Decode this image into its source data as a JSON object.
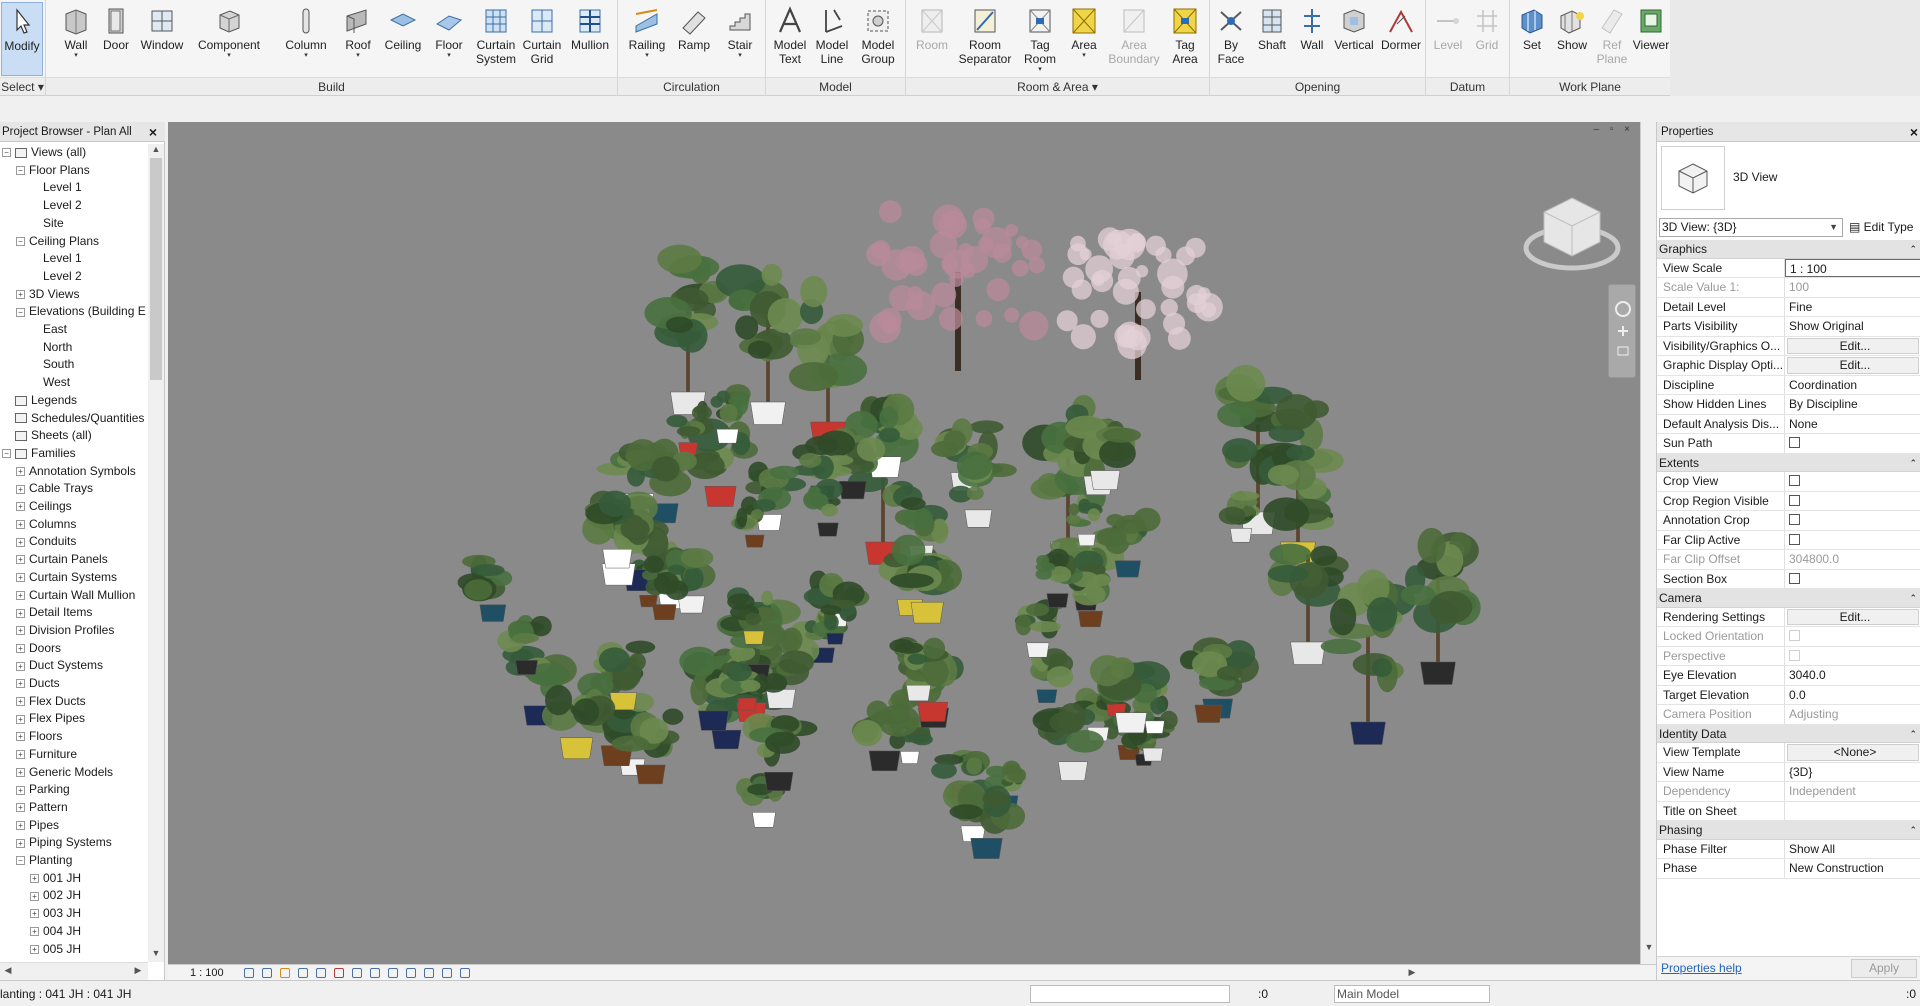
{
  "ribbon": {
    "tools": [
      {
        "label": "Modify",
        "icon": "cursor-icon"
      },
      {
        "label": "Wall",
        "icon": "wall-icon"
      },
      {
        "label": "Door",
        "icon": "door-icon"
      },
      {
        "label": "Window",
        "icon": "window-icon"
      },
      {
        "label": "Component",
        "icon": "component-icon"
      },
      {
        "label": "Column",
        "icon": "column-icon"
      },
      {
        "label": "Roof",
        "icon": "roof-icon"
      },
      {
        "label": "Ceiling",
        "icon": "ceiling-icon"
      },
      {
        "label": "Floor",
        "icon": "floor-icon"
      },
      {
        "label": "Curtain\nSystem",
        "icon": "curtain-system-icon"
      },
      {
        "label": "Curtain\nGrid",
        "icon": "curtain-grid-icon"
      },
      {
        "label": "Mullion",
        "icon": "mullion-icon"
      },
      {
        "label": "Railing",
        "icon": "railing-icon"
      },
      {
        "label": "Ramp",
        "icon": "ramp-icon"
      },
      {
        "label": "Stair",
        "icon": "stair-icon"
      },
      {
        "label": "Model\nText",
        "icon": "model-text-icon"
      },
      {
        "label": "Model\nLine",
        "icon": "model-line-icon"
      },
      {
        "label": "Model\nGroup",
        "icon": "model-group-icon"
      },
      {
        "label": "Room",
        "icon": "room-icon"
      },
      {
        "label": "Room\nSeparator",
        "icon": "room-separator-icon"
      },
      {
        "label": "Tag\nRoom",
        "icon": "tag-room-icon"
      },
      {
        "label": "Area",
        "icon": "area-icon"
      },
      {
        "label": "Area\nBoundary",
        "icon": "area-boundary-icon"
      },
      {
        "label": "Tag\nArea",
        "icon": "tag-area-icon"
      },
      {
        "label": "By\nFace",
        "icon": "by-face-icon"
      },
      {
        "label": "Shaft",
        "icon": "shaft-icon"
      },
      {
        "label": "Wall",
        "icon": "wall-opening-icon"
      },
      {
        "label": "Vertical",
        "icon": "vertical-opening-icon"
      },
      {
        "label": "Dormer",
        "icon": "dormer-icon"
      },
      {
        "label": "Level",
        "icon": "level-icon"
      },
      {
        "label": "Grid",
        "icon": "grid-icon"
      },
      {
        "label": "Set",
        "icon": "set-workplane-icon"
      },
      {
        "label": "Show",
        "icon": "show-workplane-icon"
      },
      {
        "label": "Ref\nPlane",
        "icon": "ref-plane-icon"
      },
      {
        "label": "Viewer",
        "icon": "viewer-icon"
      }
    ],
    "panels": [
      "Select",
      "Build",
      "Circulation",
      "Model",
      "Room & Area",
      "Opening",
      "Datum",
      "Work Plane"
    ]
  },
  "browser": {
    "title": "Project Browser - Plan All",
    "items": [
      "Views (all)",
      "Floor Plans",
      "Level 1",
      "Level 2",
      "Site",
      "Ceiling Plans",
      "Level 1",
      "Level 2",
      "3D Views",
      "Elevations (Building E",
      "East",
      "North",
      "South",
      "West",
      "Legends",
      "Schedules/Quantities",
      "Sheets (all)",
      "Families",
      "Annotation Symbols",
      "Cable Trays",
      "Ceilings",
      "Columns",
      "Conduits",
      "Curtain Panels",
      "Curtain Systems",
      "Curtain Wall Mullion",
      "Detail Items",
      "Division Profiles",
      "Doors",
      "Duct Systems",
      "Ducts",
      "Flex Ducts",
      "Flex Pipes",
      "Floors",
      "Furniture",
      "Generic Models",
      "Parking",
      "Pattern",
      "Pipes",
      "Piping Systems",
      "Planting",
      "001 JH",
      "002 JH",
      "003 JH",
      "004 JH",
      "005 JH"
    ]
  },
  "view": {
    "scale": "1 : 100",
    "window_controls": "– ▫ ×"
  },
  "properties": {
    "title": "Properties",
    "type_name": "3D View",
    "instance_selector": "3D View: {3D}",
    "edit_type": "Edit Type",
    "groups": [
      {
        "name": "Graphics",
        "rows": [
          {
            "name": "View Scale",
            "value": "1 : 100"
          },
          {
            "name": "Scale Value    1:",
            "value": "100"
          },
          {
            "name": "Detail Level",
            "value": "Fine"
          },
          {
            "name": "Parts Visibility",
            "value": "Show Original"
          },
          {
            "name": "Visibility/Graphics O...",
            "value": "Edit..."
          },
          {
            "name": "Graphic Display Opti...",
            "value": "Edit..."
          },
          {
            "name": "Discipline",
            "value": "Coordination"
          },
          {
            "name": "Show Hidden Lines",
            "value": "By Discipline"
          },
          {
            "name": "Default Analysis Dis...",
            "value": "None"
          },
          {
            "name": "Sun Path",
            "value": "unchecked"
          }
        ]
      },
      {
        "name": "Extents",
        "rows": [
          {
            "name": "Crop View",
            "value": "unchecked"
          },
          {
            "name": "Crop Region Visible",
            "value": "unchecked"
          },
          {
            "name": "Annotation Crop",
            "value": "unchecked"
          },
          {
            "name": "Far Clip Active",
            "value": "unchecked"
          },
          {
            "name": "Far Clip Offset",
            "value": "304800.0"
          },
          {
            "name": "Section Box",
            "value": "unchecked"
          }
        ]
      },
      {
        "name": "Camera",
        "rows": [
          {
            "name": "Rendering Settings",
            "value": "Edit..."
          },
          {
            "name": "Locked Orientation",
            "value": "unchecked"
          },
          {
            "name": "Perspective",
            "value": "unchecked"
          },
          {
            "name": "Eye Elevation",
            "value": "3040.0"
          },
          {
            "name": "Target Elevation",
            "value": "0.0"
          },
          {
            "name": "Camera Position",
            "value": "Adjusting"
          }
        ]
      },
      {
        "name": "Identity Data",
        "rows": [
          {
            "name": "View Template",
            "value": "<None>"
          },
          {
            "name": "View Name",
            "value": "{3D}"
          },
          {
            "name": "Dependency",
            "value": "Independent"
          },
          {
            "name": "Title on Sheet",
            "value": ""
          }
        ]
      },
      {
        "name": "Phasing",
        "rows": [
          {
            "name": "Phase Filter",
            "value": "Show All"
          },
          {
            "name": "Phase",
            "value": "New Construction"
          }
        ]
      }
    ],
    "help_link": "Properties help",
    "apply": "Apply"
  },
  "status": {
    "text": "lanting : 041 JH : 041 JH",
    "zero": ":0",
    "model": "Main Model",
    "filter_count": ":0"
  },
  "colors": {
    "viewport_bg": "#8a8a8a",
    "active_tool": "#c9ddf4",
    "link": "#2463b8"
  }
}
